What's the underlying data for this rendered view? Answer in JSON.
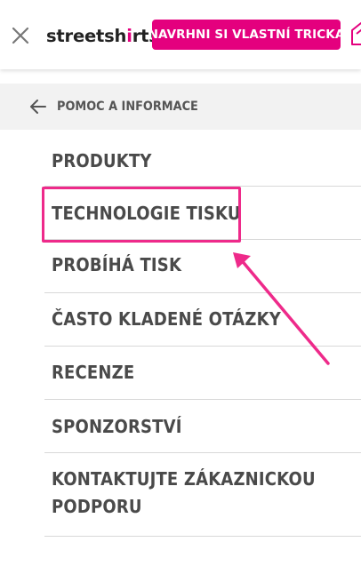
{
  "header": {
    "logo_part1": "streetsh",
    "logo_accent": "i",
    "logo_part2": "rts",
    "cta_label": "NAVRHNI SI VLASTNÍ TRICKA"
  },
  "back_bar": {
    "label": "POMOC A INFORMACE"
  },
  "menu": {
    "items": [
      {
        "label": "PRODUKTY"
      },
      {
        "label": "TECHNOLOGIE TISKU"
      },
      {
        "label": "PROBÍHÁ TISK"
      },
      {
        "label": "ČASTO KLADENÉ OTÁZKY"
      },
      {
        "label": "RECENZE"
      },
      {
        "label": "SPONZORSTVÍ"
      },
      {
        "label": "KONTAKTUJTE ZÁKAZNICKOU",
        "label2": "PODPORU"
      }
    ]
  },
  "colors": {
    "brand": "#e4007e",
    "annotation": "#ee2a8a",
    "text": "#4a4a4a",
    "back_bar_bg": "#f2f2f2"
  },
  "icons": {
    "close": "close-icon",
    "cart": "cart-icon",
    "back": "arrow-left-icon"
  }
}
